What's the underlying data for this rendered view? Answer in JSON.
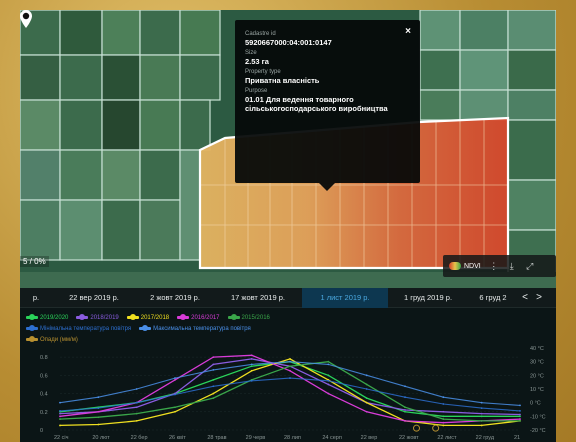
{
  "popup": {
    "cadastre_label": "Cadastre id",
    "cadastre_value": "5920667000:04:001:0147",
    "size_label": "Size",
    "size_value": "2.53 га",
    "property_label": "Property type",
    "property_value": "Приватна власність",
    "purpose_label": "Purpose",
    "purpose_value": "01.01 Для ведення товарного сільськогосподарського виробництва",
    "close": "×"
  },
  "map": {
    "opacity_label": "5 / 0%",
    "toolbar": {
      "ndvi_label": "NDVI",
      "more_icon": "⋮",
      "download_icon": "⤓",
      "expand_icon": "⤢"
    }
  },
  "dates": {
    "items": [
      "р.",
      "22 вер 2019 р.",
      "2 жовт 2019 р.",
      "17 жовт 2019 р.",
      "1 лист 2019 р.",
      "1 груд 2019 р.",
      "6 груд 2"
    ],
    "active_index": 4,
    "prev": "<",
    "next": ">"
  },
  "legend": {
    "seasons": [
      {
        "name": "2019/2020",
        "color": "#2ad35a"
      },
      {
        "name": "2018/2019",
        "color": "#8a5ce0"
      },
      {
        "name": "2017/2018",
        "color": "#f0e020"
      },
      {
        "name": "2016/2017",
        "color": "#d83cd8"
      },
      {
        "name": "2015/2016",
        "color": "#3aa64a"
      }
    ],
    "temps": [
      {
        "name": "Мінімальна температура повітря",
        "color": "#2d6fd0"
      },
      {
        "name": "Максимальна температура повітря",
        "color": "#4a8fe8"
      }
    ],
    "precip": {
      "name": "Опади (мм/м)",
      "color": "#b89030"
    }
  },
  "chart_data": {
    "type": "line",
    "y_left_ticks": [
      "0.8",
      "0.6",
      "0.4",
      "0.2",
      "0"
    ],
    "y_right_ticks": [
      "40 °C",
      "30 °C",
      "20 °C",
      "10 °C",
      "0 °C",
      "-10 °C",
      "-20 °C"
    ],
    "x_ticks": [
      "22 січ",
      "20 лют",
      "22 бер",
      "26 квіт",
      "28 трав",
      "29 черв",
      "28 лип",
      "24 серп",
      "22 вер",
      "22 жовт",
      "22 лист",
      "22 груд",
      "21"
    ],
    "ylim": [
      0,
      0.9
    ],
    "ylim_right": [
      -20,
      40
    ],
    "series": [
      {
        "name": "2019/2020",
        "color": "#2ad35a",
        "x": [
          0,
          1,
          2,
          3,
          4,
          5,
          6,
          7,
          8,
          9,
          10,
          11,
          12
        ],
        "values": [
          0.2,
          0.25,
          0.3,
          0.4,
          0.55,
          0.7,
          0.75,
          0.6,
          0.35,
          0.2,
          0.15,
          0.15,
          0.15
        ]
      },
      {
        "name": "2018/2019",
        "color": "#8a5ce0",
        "x": [
          0,
          1,
          2,
          3,
          4,
          5,
          6,
          7,
          8,
          9,
          10,
          11,
          12
        ],
        "values": [
          0.18,
          0.2,
          0.25,
          0.4,
          0.72,
          0.78,
          0.7,
          0.5,
          0.3,
          0.22,
          0.2,
          0.18,
          0.17
        ]
      },
      {
        "name": "2017/2018",
        "color": "#f0e020",
        "x": [
          0,
          1,
          2,
          3,
          4,
          5,
          6,
          7,
          8,
          9,
          10,
          11,
          12
        ],
        "values": [
          0.05,
          0.06,
          0.1,
          0.2,
          0.4,
          0.65,
          0.78,
          0.55,
          0.3,
          0.1,
          0.05,
          0.05,
          0.1
        ]
      },
      {
        "name": "2016/2017",
        "color": "#d83cd8",
        "x": [
          0,
          1,
          2,
          3,
          4,
          5,
          6,
          7,
          8,
          9,
          10,
          11,
          12
        ],
        "values": [
          0.15,
          0.2,
          0.3,
          0.55,
          0.8,
          0.82,
          0.65,
          0.4,
          0.2,
          0.1,
          0.08,
          0.1,
          0.12
        ]
      },
      {
        "name": "2015/2016",
        "color": "#3aa64a",
        "x": [
          0,
          1,
          2,
          3,
          4,
          5,
          6,
          7,
          8,
          9,
          10,
          11,
          12
        ],
        "values": [
          0.12,
          0.14,
          0.18,
          0.25,
          0.35,
          0.55,
          0.7,
          0.75,
          0.5,
          0.25,
          0.12,
          0.1,
          0.1
        ]
      },
      {
        "name": "Мінімальна температура повітря",
        "color": "#2d6fd0",
        "axis": "right",
        "x": [
          0,
          1,
          2,
          3,
          4,
          5,
          6,
          7,
          8,
          9,
          10,
          11,
          12
        ],
        "values": [
          -6,
          -4,
          0,
          6,
          12,
          16,
          18,
          16,
          10,
          4,
          -1,
          -4,
          -6
        ]
      },
      {
        "name": "Максимальна температура повітря",
        "color": "#4a8fe8",
        "axis": "right",
        "x": [
          0,
          1,
          2,
          3,
          4,
          5,
          6,
          7,
          8,
          9,
          10,
          11,
          12
        ],
        "values": [
          0,
          4,
          10,
          18,
          24,
          28,
          30,
          28,
          20,
          12,
          4,
          0,
          -2
        ]
      }
    ],
    "precip_points": [
      {
        "x": 9.3,
        "value": 0.02
      },
      {
        "x": 9.8,
        "value": 0.02
      }
    ]
  },
  "colors": {
    "accent": "#4aa8e0",
    "field_selected_border": "#ffffff"
  }
}
